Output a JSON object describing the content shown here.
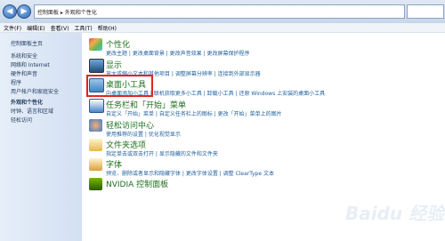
{
  "address": {
    "path": "控制面板 ▸ 外观和个性化"
  },
  "menu": [
    "文件(F)",
    "编辑(E)",
    "查看(V)",
    "工具(T)",
    "帮助(H)"
  ],
  "sidebar": {
    "items": [
      "控制面板主页",
      "系统和安全",
      "网络和 Internet",
      "硬件和声音",
      "程序",
      "用户帐户和家庭安全",
      "外观和个性化",
      "时钟、语言和区域",
      "轻松访问"
    ]
  },
  "categories": [
    {
      "title": "个性化",
      "links": "更改主题 | 更改桌面背景 | 更改声音效果 | 更改屏幕保护程序"
    },
    {
      "title": "显示",
      "links": "放大或缩小文本和其他项目 | 调整屏幕分辨率 | 连接到外部显示器"
    },
    {
      "title": "桌面小工具",
      "links": "向桌面添加小工具 | 联机获取更多小工具 | 卸载小工具 | 还原 Windows 上安装的桌面小工具"
    },
    {
      "title": "任务栏和「开始」菜单",
      "links": "自定义「开始」菜单 | 自定义任务栏上的图标 | 更改「开始」菜单上的图片"
    },
    {
      "title": "轻松访问中心",
      "links": "使用推荐的设置 | 优化视觉显示"
    },
    {
      "title": "文件夹选项",
      "links": "指定单击或双击打开 | 显示隐藏的文件和文件夹"
    },
    {
      "title": "字体",
      "links": "预览、删除或者显示和隐藏字体 | 更改字体设置 | 调整 ClearType 文本"
    },
    {
      "title": "NVIDIA 控制面板",
      "links": ""
    }
  ],
  "colors": {
    "highlight": "#e0261f",
    "title_green": "#1e6f1e",
    "link_blue": "#1e5f9e"
  },
  "watermark": "Baidu 经验"
}
